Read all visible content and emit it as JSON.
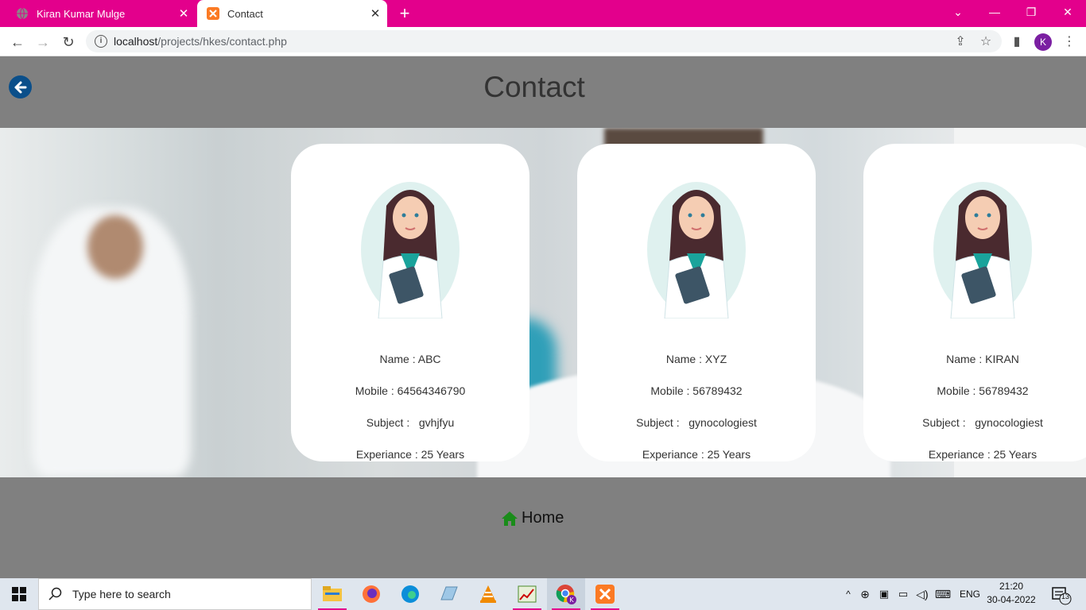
{
  "browser": {
    "tabs": [
      {
        "title": "Kiran Kumar Mulge",
        "active": false
      },
      {
        "title": "Contact",
        "active": true
      }
    ],
    "new_tab": "+",
    "url_host": "localhost",
    "url_path": "/projects/hkes/contact.php",
    "avatar_letter": "K"
  },
  "page": {
    "title": "Contact",
    "cards": [
      {
        "name": "Name : ABC",
        "mobile": "Mobile : 64564346790",
        "subject": "Subject :   gvhjfyu",
        "experience": "Experiance : 25 Years"
      },
      {
        "name": "Name : XYZ",
        "mobile": "Mobile : 56789432",
        "subject": "Subject :   gynocologiest",
        "experience": "Experiance : 25 Years"
      },
      {
        "name": "Name : KIRAN",
        "mobile": "Mobile : 56789432",
        "subject": "Subject :   gynocologiest",
        "experience": "Experiance : 25 Years"
      }
    ],
    "home_link": "Home"
  },
  "taskbar": {
    "search_placeholder": "Type here to search",
    "language": "ENG",
    "time": "21:20",
    "date": "30-04-2022",
    "notifications": "13"
  },
  "colors": {
    "tab_strip": "#e3008c",
    "page_bg": "#808080",
    "back_button": "#0b4f8a",
    "home_icon": "#1a8c1a"
  }
}
